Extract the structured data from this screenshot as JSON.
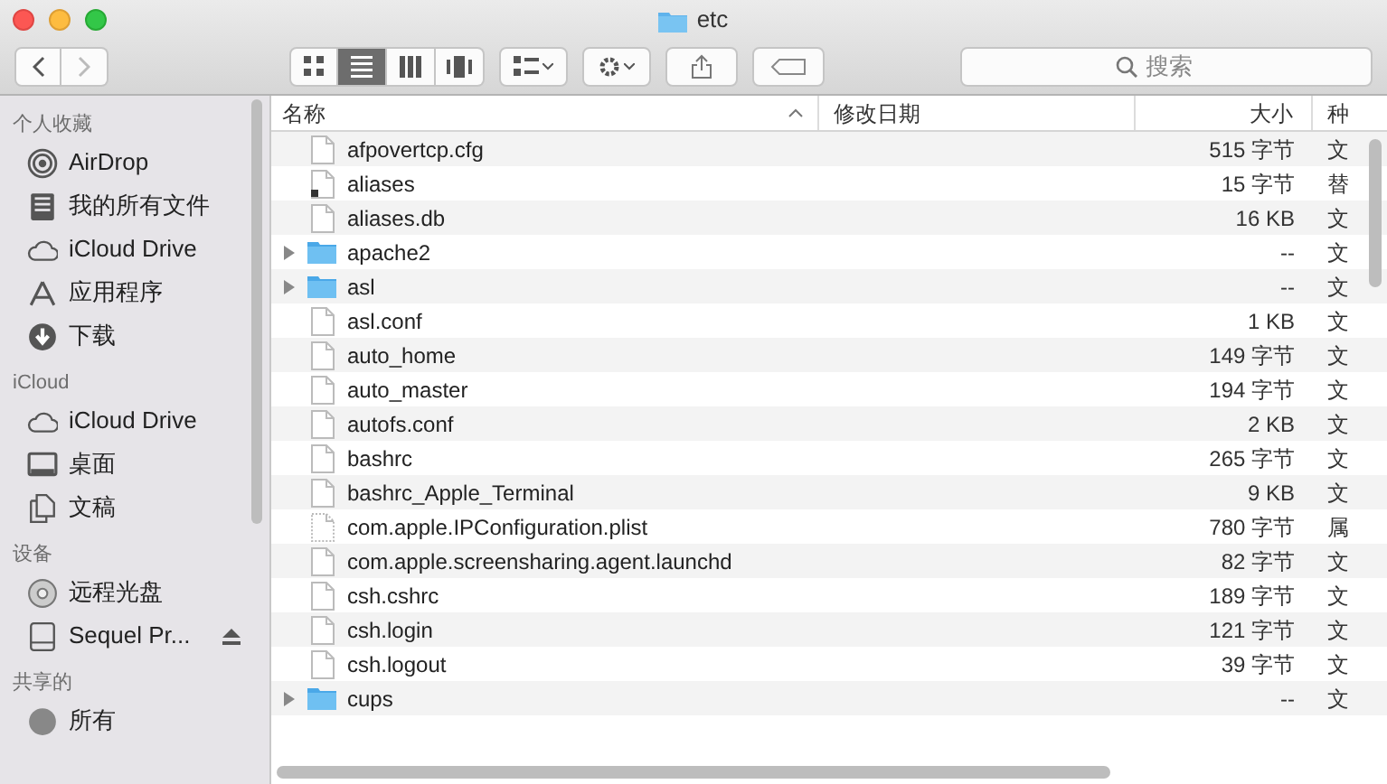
{
  "window": {
    "title": "etc"
  },
  "toolbar": {
    "view_modes": [
      {
        "selected": false
      },
      {
        "selected": true
      },
      {
        "selected": false
      },
      {
        "selected": false
      }
    ],
    "search": {
      "placeholder": "搜索"
    }
  },
  "sidebar": {
    "sections": [
      {
        "title": "个人收藏",
        "items": [
          {
            "label": "AirDrop",
            "kind": "airdrop",
            "ejectable": false
          },
          {
            "label": "我的所有文件",
            "kind": "allfiles",
            "ejectable": false
          },
          {
            "label": "iCloud Drive",
            "kind": "cloud",
            "ejectable": false
          },
          {
            "label": "应用程序",
            "kind": "apps",
            "ejectable": false
          },
          {
            "label": "下载",
            "kind": "download",
            "ejectable": false
          }
        ]
      },
      {
        "title": "iCloud",
        "items": [
          {
            "label": "iCloud Drive",
            "kind": "cloud",
            "ejectable": false
          },
          {
            "label": "桌面",
            "kind": "desktop",
            "ejectable": false
          },
          {
            "label": "文稿",
            "kind": "docs",
            "ejectable": false
          }
        ]
      },
      {
        "title": "设备",
        "items": [
          {
            "label": "远程光盘",
            "kind": "disc",
            "ejectable": false
          },
          {
            "label": "Sequel Pr...",
            "kind": "drive",
            "ejectable": true
          }
        ]
      },
      {
        "title": "共享的",
        "items": [
          {
            "label": "所有",
            "kind": "network",
            "ejectable": false
          }
        ]
      }
    ]
  },
  "table": {
    "columns": [
      {
        "label": "名称",
        "sorted": true
      },
      {
        "label": "修改日期",
        "sorted": false
      },
      {
        "label": "大小",
        "sorted": false
      },
      {
        "label": "种",
        "sorted": false
      }
    ],
    "rows": [
      {
        "name": "afpovertcp.cfg",
        "kind": "file",
        "size": "515 字节",
        "type": "文"
      },
      {
        "name": "aliases",
        "kind": "alias",
        "size": "15 字节",
        "type": "替"
      },
      {
        "name": "aliases.db",
        "kind": "file",
        "size": "16 KB",
        "type": "文"
      },
      {
        "name": "apache2",
        "kind": "folder",
        "expanded": false,
        "size": "--",
        "type": "文"
      },
      {
        "name": "asl",
        "kind": "folder",
        "expanded": false,
        "size": "--",
        "type": "文"
      },
      {
        "name": "asl.conf",
        "kind": "file",
        "size": "1 KB",
        "type": "文"
      },
      {
        "name": "auto_home",
        "kind": "file",
        "size": "149 字节",
        "type": "文"
      },
      {
        "name": "auto_master",
        "kind": "file",
        "size": "194 字节",
        "type": "文"
      },
      {
        "name": "autofs.conf",
        "kind": "file",
        "size": "2 KB",
        "type": "文"
      },
      {
        "name": "bashrc",
        "kind": "file",
        "size": "265 字节",
        "type": "文"
      },
      {
        "name": "bashrc_Apple_Terminal",
        "kind": "file",
        "size": "9 KB",
        "type": "文"
      },
      {
        "name": "com.apple.IPConfiguration.plist",
        "kind": "plist",
        "size": "780 字节",
        "type": "属"
      },
      {
        "name": "com.apple.screensharing.agent.launchd",
        "kind": "file",
        "size": "82 字节",
        "type": "文"
      },
      {
        "name": "csh.cshrc",
        "kind": "file",
        "size": "189 字节",
        "type": "文"
      },
      {
        "name": "csh.login",
        "kind": "file",
        "size": "121 字节",
        "type": "文"
      },
      {
        "name": "csh.logout",
        "kind": "file",
        "size": "39 字节",
        "type": "文"
      },
      {
        "name": "cups",
        "kind": "folder",
        "expanded": false,
        "size": "--",
        "type": "文"
      }
    ]
  }
}
